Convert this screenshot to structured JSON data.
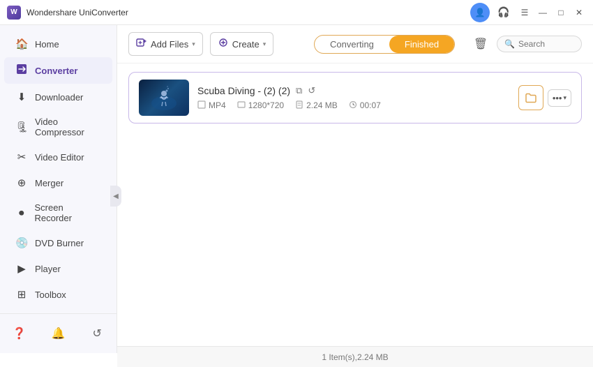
{
  "app": {
    "title": "Wondershare UniConverter",
    "logo_text": "W"
  },
  "titlebar": {
    "avatar_icon": "👤",
    "bell_icon": "🔔",
    "menu_icon": "☰",
    "minimize_icon": "—",
    "maximize_icon": "□",
    "close_icon": "✕"
  },
  "sidebar": {
    "items": [
      {
        "id": "home",
        "label": "Home",
        "icon": "🏠",
        "active": false
      },
      {
        "id": "converter",
        "label": "Converter",
        "icon": "⬛",
        "active": true
      },
      {
        "id": "downloader",
        "label": "Downloader",
        "icon": "⬇",
        "active": false
      },
      {
        "id": "video-compressor",
        "label": "Video Compressor",
        "icon": "🗜",
        "active": false
      },
      {
        "id": "video-editor",
        "label": "Video Editor",
        "icon": "✂",
        "active": false
      },
      {
        "id": "merger",
        "label": "Merger",
        "icon": "⊕",
        "active": false
      },
      {
        "id": "screen-recorder",
        "label": "Screen Recorder",
        "icon": "⏺",
        "active": false
      },
      {
        "id": "dvd-burner",
        "label": "DVD Burner",
        "icon": "💿",
        "active": false
      },
      {
        "id": "player",
        "label": "Player",
        "icon": "▶",
        "active": false
      },
      {
        "id": "toolbox",
        "label": "Toolbox",
        "icon": "⚙",
        "active": false
      }
    ],
    "footer": [
      {
        "id": "help",
        "icon": "❓"
      },
      {
        "id": "notifications",
        "icon": "🔔"
      },
      {
        "id": "feedback",
        "icon": "↺"
      }
    ],
    "collapse_icon": "◀"
  },
  "toolbar": {
    "add_file_label": "Add Files",
    "add_file_icon": "➕",
    "add_dropdown_icon": "▾",
    "create_label": "Create",
    "create_icon": "✦",
    "tabs": [
      {
        "id": "converting",
        "label": "Converting",
        "active": false
      },
      {
        "id": "finished",
        "label": "Finished",
        "active": true
      }
    ],
    "trash_icon": "🗑",
    "search_icon": "🔍",
    "search_placeholder": "Search"
  },
  "files": [
    {
      "id": "file-1",
      "name": "Scuba Diving - (2) (2)",
      "format": "MP4",
      "resolution": "1280*720",
      "size": "2.24 MB",
      "duration": "00:07",
      "open_icon": "⧉",
      "refresh_icon": "↺",
      "folder_icon": "📁",
      "more_icon": "•••",
      "dropdown_icon": "▾"
    }
  ],
  "statusbar": {
    "text": "1 Item(s),2.24 MB"
  }
}
